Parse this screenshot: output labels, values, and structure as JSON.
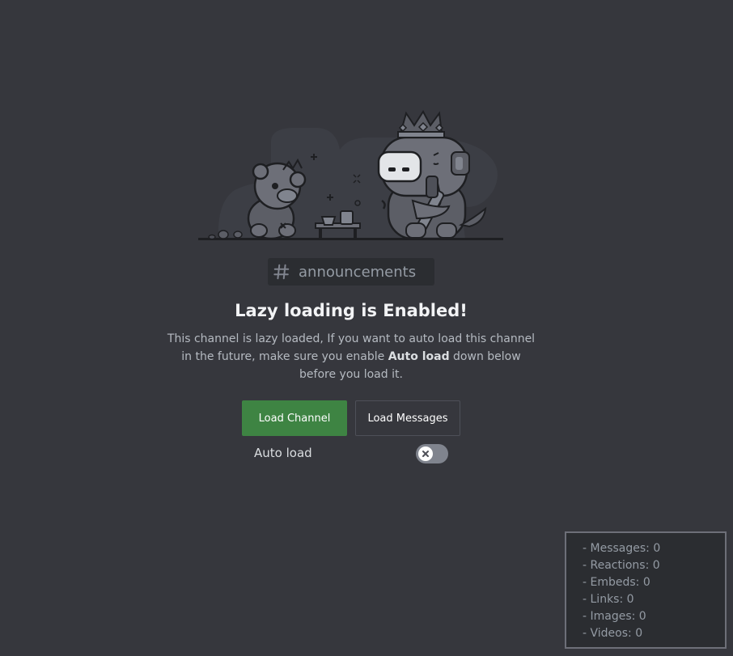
{
  "channel": {
    "icon": "hash-icon",
    "name": "announcements"
  },
  "notice": {
    "title": "Lazy loading is Enabled!",
    "description_part1": "This channel is lazy loaded, If you want to auto load this channel in the future, make sure you enable ",
    "description_bold": "Auto load",
    "description_part2": " down below before you load it."
  },
  "actions": {
    "load_channel_label": "Load Channel",
    "load_messages_label": "Load Messages"
  },
  "auto_load": {
    "label": "Auto load",
    "enabled": false,
    "knob_icon": "close-icon"
  },
  "stats": [
    "- Messages: 0",
    "- Reactions: 0",
    "- Embeds: 0",
    "- Links: 0",
    "- Images: 0",
    "- Videos: 0"
  ],
  "colors": {
    "background": "#36373d",
    "primary_button": "#3e8443",
    "toggle_off": "#80848e"
  }
}
